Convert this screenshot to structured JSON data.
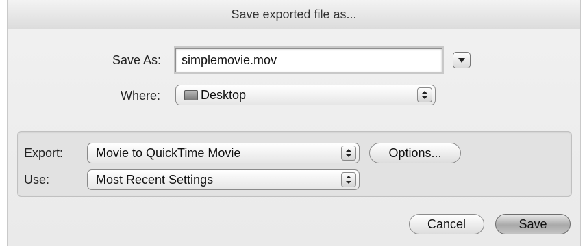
{
  "dialog": {
    "title": "Save exported file as..."
  },
  "save_as": {
    "label": "Save As:",
    "value": "simplemovie.mov"
  },
  "where": {
    "label": "Where:",
    "selected": "Desktop",
    "icon": "desktop-folder-icon"
  },
  "export": {
    "label": "Export:",
    "selected": "Movie to QuickTime Movie",
    "options_button": "Options..."
  },
  "use": {
    "label": "Use:",
    "selected": "Most Recent Settings"
  },
  "buttons": {
    "cancel": "Cancel",
    "save": "Save"
  },
  "icons": {
    "disclosure": "disclosure-triangle-icon",
    "popup_arrows": "up-down-arrows-icon"
  }
}
